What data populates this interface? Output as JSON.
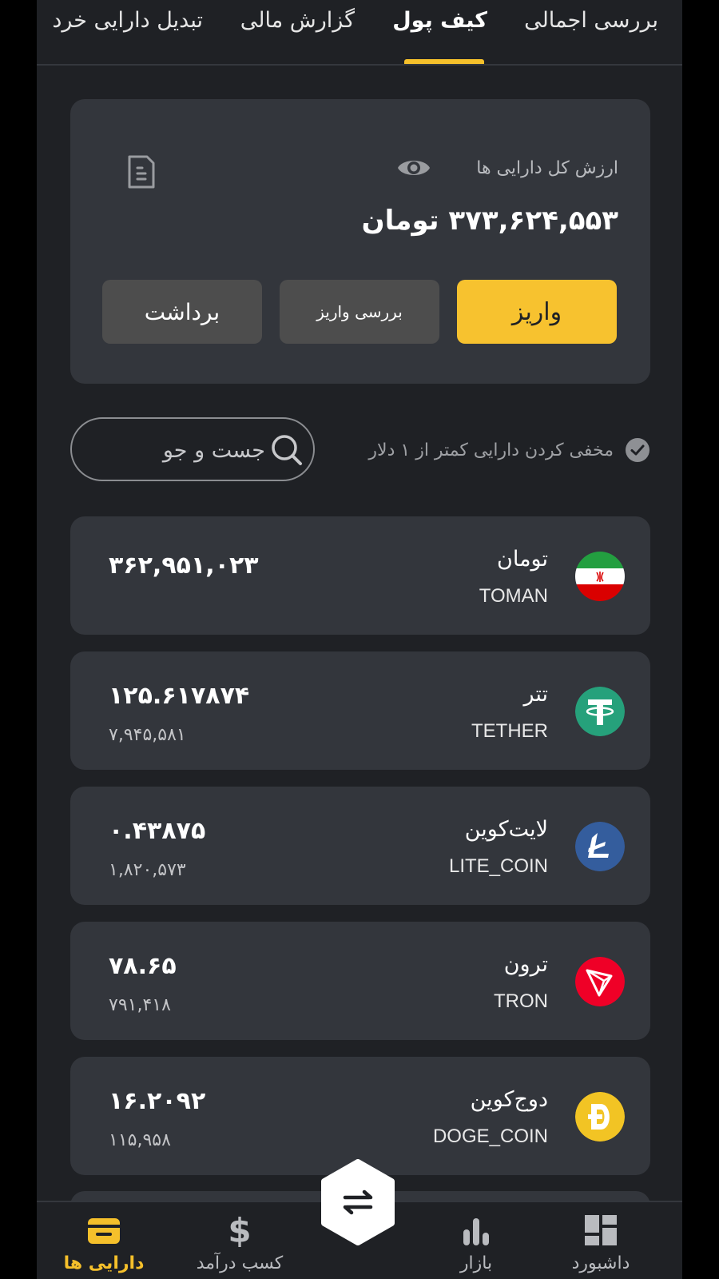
{
  "tabs": [
    {
      "label": "بررسی اجمالی"
    },
    {
      "label": "کیف پول"
    },
    {
      "label": "گزارش مالی"
    },
    {
      "label": "تبدیل دارایی خرد"
    }
  ],
  "balance": {
    "label": "ارزش کل دارایی ها",
    "value": "۳۷۳,۶۲۴,۵۵۳ تومان",
    "deposit_label": "واریز",
    "check_deposit_label": "بررسی واریز",
    "withdraw_label": "برداشت"
  },
  "filter": {
    "hide_small_label": "مخفی کردن دارایی کمتر از ۱ دلار",
    "search_placeholder": "جست و جو"
  },
  "assets": [
    {
      "name": "تومان",
      "code": "TOMAN",
      "amount": "۳۶۲,۹۵۱,۰۲۳",
      "value": "",
      "icon": "iran-flag-icon"
    },
    {
      "name": "تتر",
      "code": "TETHER",
      "amount": "۱۲۵.۶۱۷۸۷۴",
      "value": "۷,۹۴۵,۵۸۱",
      "icon": "tether-icon",
      "color": "#26a17b"
    },
    {
      "name": "لایت‌کوین",
      "code": "LITE_COIN",
      "amount": "۰.۴۳۸۷۵",
      "value": "۱,۸۲۰,۵۷۳",
      "icon": "litecoin-icon",
      "color": "#345d9d"
    },
    {
      "name": "ترون",
      "code": "TRON",
      "amount": "۷۸.۶۵",
      "value": "۷۹۱,۴۱۸",
      "icon": "tron-icon",
      "color": "#ef0027"
    },
    {
      "name": "دوج‌کوین",
      "code": "DOGE_COIN",
      "amount": "۱۶.۲۰۹۲",
      "value": "۱۱۵,۹۵۸",
      "icon": "dogecoin-icon",
      "color": "#f2c424"
    }
  ],
  "nav": [
    {
      "label": "دارایی ها",
      "icon": "wallet-icon",
      "active": true
    },
    {
      "label": "کسب درآمد",
      "icon": "dollar-icon"
    },
    {
      "label": "بازار",
      "icon": "bar-chart-icon"
    },
    {
      "label": "داشبورد",
      "icon": "dashboard-icon"
    }
  ],
  "colors": {
    "accent": "#f5c02b",
    "background": "#1f2125",
    "card": "#33363c"
  }
}
